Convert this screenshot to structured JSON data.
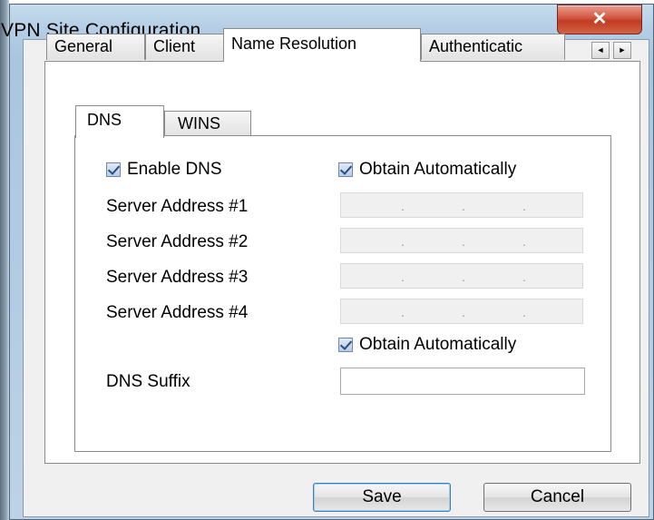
{
  "window": {
    "title": "VPN Site Configuration",
    "close_glyph": "✕"
  },
  "tabs": [
    "General",
    "Client",
    "Name Resolution",
    "Authenticatic"
  ],
  "tab_scroll": {
    "left": "◄",
    "right": "►"
  },
  "subtabs": [
    "DNS",
    "WINS"
  ],
  "dns": {
    "enable_label": "Enable DNS",
    "enable_checked": true,
    "obtain_servers_label": "Obtain Automatically",
    "obtain_servers_checked": true,
    "servers": [
      {
        "label": "Server Address #1",
        "value": ""
      },
      {
        "label": "Server Address #2",
        "value": ""
      },
      {
        "label": "Server Address #3",
        "value": ""
      },
      {
        "label": "Server Address #4",
        "value": ""
      }
    ],
    "ip_separator": ".",
    "obtain_suffix_label": "Obtain Automatically",
    "obtain_suffix_checked": true,
    "suffix_label": "DNS Suffix",
    "suffix_value": ""
  },
  "buttons": {
    "save": "Save",
    "cancel": "Cancel"
  },
  "icons": {
    "checkbox": "checkmark-icon",
    "close": "close-icon",
    "scroll_left": "arrow-left-icon",
    "scroll_right": "arrow-right-icon"
  }
}
